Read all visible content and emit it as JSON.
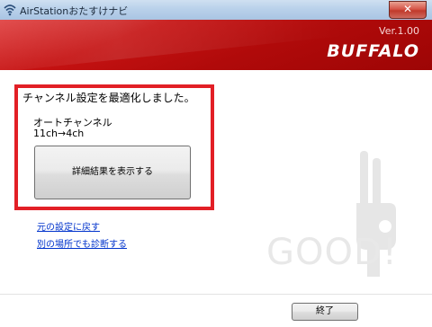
{
  "window": {
    "title": "AirStationおたすけナビ",
    "close_glyph": "✕"
  },
  "header": {
    "version": "Ver.1.00",
    "logo_text": "BUFFALO",
    "background_color": "#c51212"
  },
  "content": {
    "status_message": "チャンネル設定を最適化しました。",
    "channel_mode": "オートチャンネル",
    "channel_change": "11ch→4ch",
    "details_button": "詳細結果を表示する",
    "highlight_color": "#e21f26"
  },
  "links": [
    {
      "label": "元の設定に戻す"
    },
    {
      "label": "別の場所でも診断する"
    }
  ],
  "decoration": {
    "watermark_text": "GOOD!",
    "icon": "thumbs-up-icon"
  },
  "footer": {
    "end_button": "終了"
  }
}
